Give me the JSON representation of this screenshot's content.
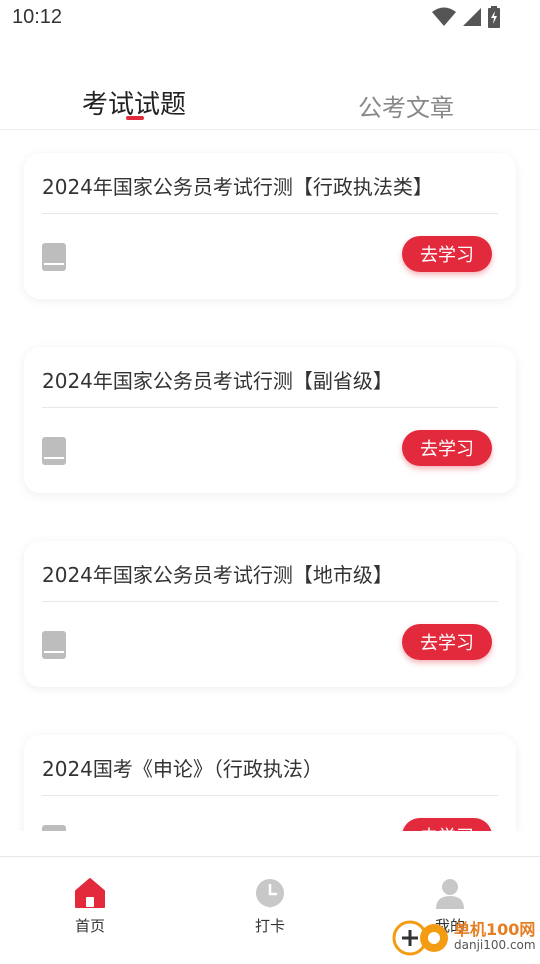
{
  "status": {
    "time": "10:12"
  },
  "tabs": [
    {
      "label": "考试试题",
      "active": true
    },
    {
      "label": "公考文章",
      "active": false
    }
  ],
  "accent_color": "#e12b3a",
  "cards": [
    {
      "title": "2024年国家公务员考试行测【行政执法类】",
      "button": "去学习"
    },
    {
      "title": "2024年国家公务员考试行测【副省级】",
      "button": "去学习"
    },
    {
      "title": "2024年国家公务员考试行测【地市级】",
      "button": "去学习"
    },
    {
      "title": "2024国考《申论》（行政执法）",
      "button": "去学习"
    }
  ],
  "bottom_nav": [
    {
      "label": "首页",
      "icon": "home-icon",
      "active": true
    },
    {
      "label": "打卡",
      "icon": "clock-pin-icon",
      "active": false
    },
    {
      "label": "我的",
      "icon": "user-icon",
      "active": false
    }
  ],
  "watermark": {
    "text": "单机100网",
    "sub": "danji100.com"
  }
}
